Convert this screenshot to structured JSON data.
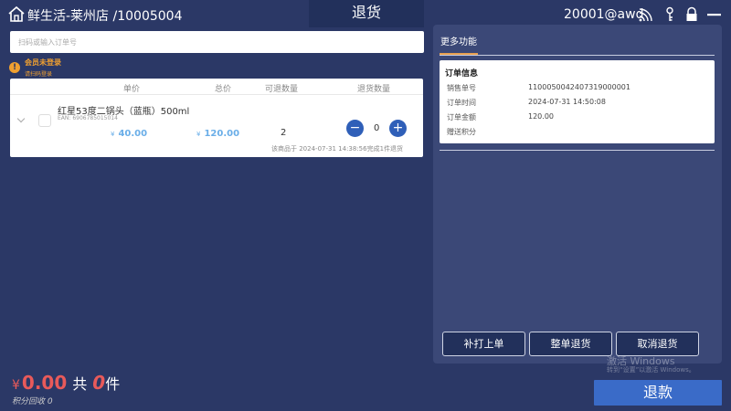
{
  "header": {
    "store": "鲜生活-莱州店 /10005004",
    "title": "退货",
    "user": "20001@awd"
  },
  "search": {
    "placeholder": "扫码或输入订单号"
  },
  "member": {
    "title": "会员未登录",
    "sub": "请扫码登录"
  },
  "table": {
    "headers": {
      "unit_price": "单价",
      "total": "总价",
      "returnable": "可退数量",
      "return_qty": "退货数量"
    },
    "rows": [
      {
        "name": "红星53度二锅头（蓝瓶）500ml",
        "ean": "EAN: 6906785015014",
        "currency": "¥",
        "unit_price": "40.00",
        "total": "120.00",
        "returnable": "2",
        "return_qty": "0",
        "minus": "−",
        "plus": "+",
        "note": "该商品于 2024-07-31 14:38:56完成1件退货"
      }
    ]
  },
  "panel": {
    "tab": "更多功能",
    "order_info": {
      "title": "订单信息",
      "fields": [
        {
          "label": "销售单号",
          "value": "1100050042407319000001"
        },
        {
          "label": "订单时间",
          "value": "2024-07-31 14:50:08"
        },
        {
          "label": "订单金额",
          "value": "120.00"
        },
        {
          "label": "赠送积分",
          "value": ""
        }
      ]
    },
    "buttons": {
      "reprint": "补打上单",
      "whole_return": "整单退货",
      "cancel_return": "取消退货"
    }
  },
  "watermark": {
    "line1": "激活 Windows",
    "line2": "转到“设置”以激活 Windows。"
  },
  "footer": {
    "currency": "¥",
    "amount": "0.00",
    "total_label": "共",
    "count": "0",
    "unit": "件",
    "points": "积分回收 0",
    "refund": "退款"
  },
  "colors": {
    "background": "#2b3866",
    "accent": "#3a6bc8",
    "price": "#6aaee8",
    "total": "#e85a5a",
    "warning": "#f0a030"
  },
  "icons": [
    "home-icon",
    "wifi-icon",
    "key-icon",
    "lock-icon",
    "minimize-icon",
    "warning-icon",
    "chevron-down-icon",
    "minus-icon",
    "plus-icon"
  ]
}
